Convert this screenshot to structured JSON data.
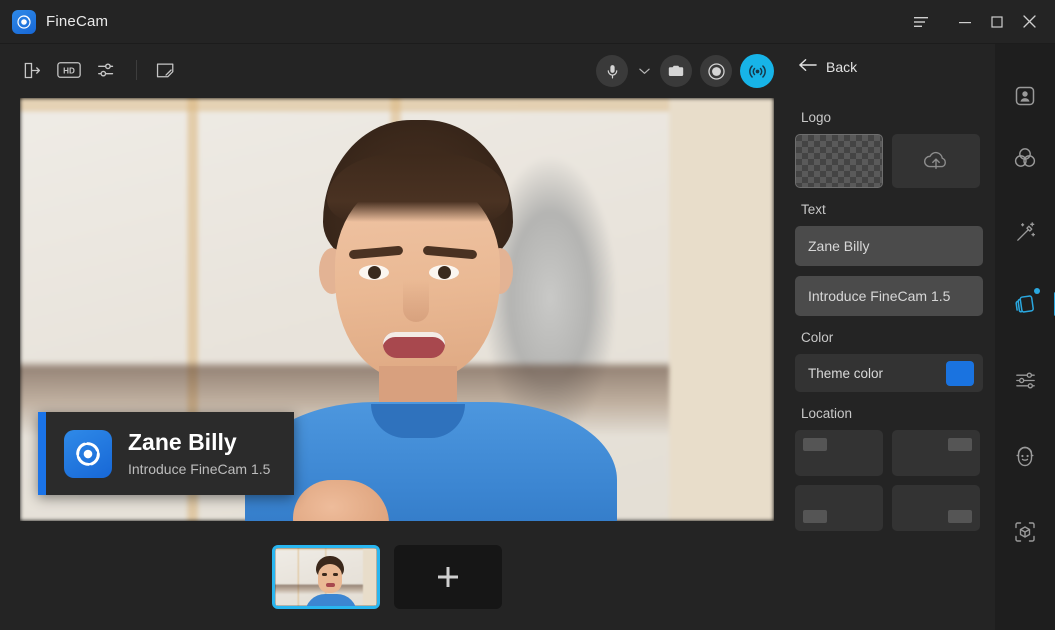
{
  "window": {
    "app_name": "FineCam",
    "logo_icon": "finecam-shutter-icon",
    "controls": [
      {
        "name": "menu-button",
        "icon": "hamburger-menu-icon"
      },
      {
        "name": "minimize-button",
        "icon": "minimize-icon"
      },
      {
        "name": "maximize-button",
        "icon": "maximize-icon"
      },
      {
        "name": "close-button",
        "icon": "close-icon"
      }
    ]
  },
  "toolbar": {
    "left_items": [
      {
        "name": "exit-button",
        "icon": "exit-door-arrow-icon"
      },
      {
        "name": "hd-quality-button",
        "icon": "hd-badge-icon",
        "label": "HD"
      },
      {
        "name": "settings-sliders-button",
        "icon": "sliders-icon"
      },
      {
        "name": "notes-button",
        "icon": "note-edit-icon"
      }
    ],
    "center_items": [
      {
        "name": "microphone-button",
        "icon": "microphone-icon"
      },
      {
        "name": "microphone-dropdown",
        "icon": "chevron-down-icon"
      },
      {
        "name": "snapshot-button",
        "icon": "camera-icon"
      },
      {
        "name": "record-button",
        "icon": "record-circle-icon"
      },
      {
        "name": "broadcast-button",
        "icon": "broadcast-waves-icon",
        "active": true
      }
    ],
    "back_label": "Back",
    "back_icon": "arrow-left-icon"
  },
  "preview": {
    "overlay_card": {
      "name": "Zane Billy",
      "subtitle": "Introduce FineCam 1.5",
      "logo_icon": "finecam-shutter-icon",
      "accent_color": "#1a73e8"
    }
  },
  "scenes": {
    "items": [
      {
        "name": "scene-thumbnail-1",
        "selected": true
      },
      {
        "name": "add-scene-button",
        "icon": "plus-icon",
        "label": "+"
      }
    ]
  },
  "panel": {
    "sections": {
      "logo": {
        "label": "Logo",
        "tiles": [
          {
            "name": "logo-transparent-tile",
            "selected": true
          },
          {
            "name": "logo-upload-tile",
            "icon": "cloud-upload-icon"
          }
        ]
      },
      "text": {
        "label": "Text",
        "fields": [
          {
            "name": "overlay-name-input",
            "value": "Zane Billy"
          },
          {
            "name": "overlay-subtitle-input",
            "value": "Introduce FineCam 1.5"
          }
        ]
      },
      "color": {
        "label": "Color",
        "row_label": "Theme color",
        "swatch_hex": "#1a73e0"
      },
      "location": {
        "label": "Location",
        "options": [
          {
            "name": "location-top-left",
            "position": "top-left"
          },
          {
            "name": "location-top-right",
            "position": "top-right"
          },
          {
            "name": "location-bottom-left",
            "position": "bottom-left"
          },
          {
            "name": "location-bottom-right",
            "position": "bottom-right"
          }
        ]
      }
    }
  },
  "rail": {
    "items": [
      {
        "name": "rail-portrait",
        "icon": "portrait-frame-icon",
        "active": false
      },
      {
        "name": "rail-background",
        "icon": "three-circles-icon",
        "active": false
      },
      {
        "name": "rail-beautify",
        "icon": "magic-wand-icon",
        "active": false
      },
      {
        "name": "rail-overlay",
        "icon": "layers-overlay-icon",
        "active": true,
        "badge": true
      },
      {
        "name": "rail-adjustments",
        "icon": "sliders-icon",
        "active": false
      },
      {
        "name": "rail-avatar",
        "icon": "face-avatar-icon",
        "active": false
      },
      {
        "name": "rail-3d-object",
        "icon": "cube-frame-icon",
        "active": false
      }
    ]
  },
  "colors": {
    "accent_blue": "#1a73e8",
    "live_cyan": "#17b4e8",
    "rail_active": "#2aa8e0",
    "background": "#242424"
  }
}
